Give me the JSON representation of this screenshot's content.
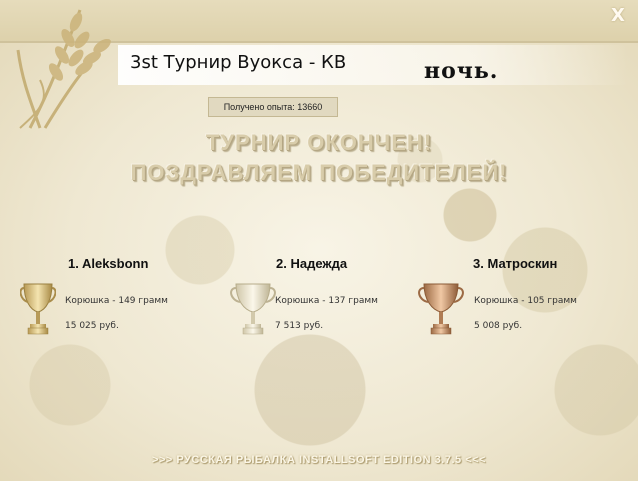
{
  "window": {
    "close_label": "X",
    "tournament_title": "3st Турнир Вуокса - КВ",
    "time_of_day": "ночь.",
    "experience_text": "Получено опыта: 13660"
  },
  "headline": {
    "line1": "ТУРНИР ОКОНЧЕН!",
    "line2": "ПОЗДРАВЛЯЕМ ПОБЕДИТЕЛЕЙ!"
  },
  "winners": [
    {
      "name": "1. Aleksbonn",
      "fish": "Корюшка - 149 грамм",
      "money": "15 025 руб.",
      "trophy": "gold-trophy-icon"
    },
    {
      "name": "2. Надежда",
      "fish": "Корюшка - 137 грамм",
      "money": "7 513 руб.",
      "trophy": "silver-trophy-icon"
    },
    {
      "name": "3. Матроскин",
      "fish": "Корюшка - 105 грамм",
      "money": "5 008 руб.",
      "trophy": "bronze-trophy-icon"
    }
  ],
  "footer": ">>> РУССКАЯ РЫБАЛКА INSTALLSOFT EDITION 3.7.5 <<<",
  "colors": {
    "gold": "#d9c48a",
    "silver": "#e2dcc7",
    "bronze": "#c99a6e",
    "background": "#efe8d2",
    "topbar": "#e2d7b3"
  }
}
